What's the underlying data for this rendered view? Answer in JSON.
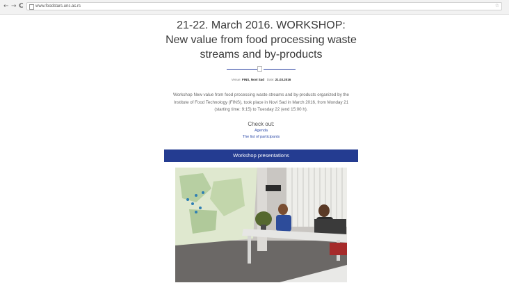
{
  "browser": {
    "back_icon": "←",
    "forward_icon": "→",
    "reload_icon": "C",
    "url": "www.foodstars.uns.ac.rs",
    "star_icon": "☆"
  },
  "page": {
    "title": "21-22. March 2016. WORKSHOP: New value from food processing waste streams and by-products",
    "meta": {
      "venue_label": "Venue:",
      "venue_value": "FINS, Novi Sad",
      "date_label": "Date:",
      "date_value": "21.03.2016"
    },
    "description": "Workshop New value from food processing waste streams and by-products organized by the Institute of Food Technology (FINS), took place in Novi Sad in March 2016, from Monday 21 (starting time: 9:15) to Tuesday 22 (end 15:00 h).",
    "check_out": "Check out:",
    "links": [
      "Agenda",
      "The list of participants"
    ],
    "banner": "Workshop presentations"
  },
  "colors": {
    "accent": "#243c91",
    "link": "#2d4aa8"
  }
}
